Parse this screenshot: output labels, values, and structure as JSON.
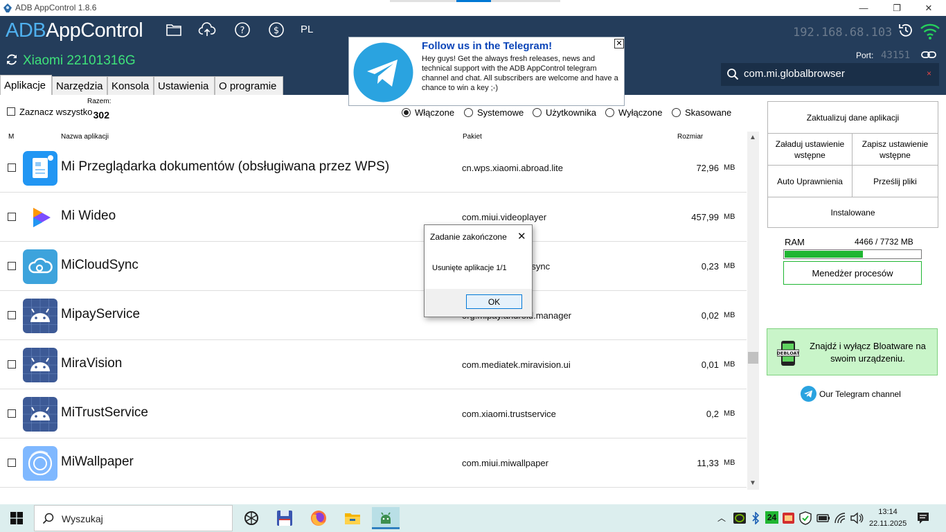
{
  "window": {
    "title": "ADB AppControl 1.8.6",
    "minimize": "—",
    "maximize": "❐",
    "close": "✕"
  },
  "header": {
    "logo_prefix": "ADB",
    "logo_main": "AppControl",
    "language": "PL",
    "device_name": "Xiaomi 22101316G",
    "ip": "192.168.68.103",
    "port_label": "Port:",
    "port_value": "43151",
    "search_value": "com.mi.globalbrowser",
    "search_clear": "×",
    "icons": [
      "folder-icon",
      "cloud-upload-icon",
      "help-icon",
      "donate-icon",
      "refresh-icon",
      "history-icon",
      "wifi-icon",
      "link-icon",
      "search-icon"
    ]
  },
  "banner": {
    "title": "Follow us in the Telegram!",
    "text": "Hey guys! Get the always fresh releases, news and technical support with the ADB AppControl telegram channel and chat. All subscribers are welcome and have a chance to win a key ;-)",
    "close": "✕"
  },
  "tabs": [
    {
      "label": "Aplikacje",
      "active": true
    },
    {
      "label": "Narzędzia",
      "active": false
    },
    {
      "label": "Konsola",
      "active": false
    },
    {
      "label": "Ustawienia",
      "active": false
    },
    {
      "label": "O programie",
      "active": false
    }
  ],
  "filters": {
    "select_all": "Zaznacz wszystko",
    "total_label": "Razem:",
    "total_value": "302",
    "radios": [
      {
        "label": "Włączone",
        "checked": true
      },
      {
        "label": "Systemowe",
        "checked": false
      },
      {
        "label": "Użytkownika",
        "checked": false
      },
      {
        "label": "Wyłączone",
        "checked": false
      },
      {
        "label": "Skasowane",
        "checked": false
      }
    ]
  },
  "table": {
    "columns": [
      "M",
      "Nazwa aplikacji",
      "Pakiet",
      "Rozmiar"
    ],
    "rows": [
      {
        "name": "Mi Przeglądarka dokumentów (obsługiwana przez WPS)",
        "package": "cn.wps.xiaomi.abroad.lite",
        "size": "72,96",
        "unit": "MB",
        "icon": "document-viewer-icon"
      },
      {
        "name": "Mi Wideo",
        "package": "com.miui.videoplayer",
        "size": "457,99",
        "unit": "MB",
        "icon": "video-player-icon"
      },
      {
        "name": "MiCloudSync",
        "package": "com.miui.micloudsync",
        "size": "0,23",
        "unit": "MB",
        "icon": "cloud-sync-icon"
      },
      {
        "name": "MipayService",
        "package": "org.mipay.android.manager",
        "size": "0,02",
        "unit": "MB",
        "icon": "android-icon"
      },
      {
        "name": "MiraVision",
        "package": "com.mediatek.miravision.ui",
        "size": "0,01",
        "unit": "MB",
        "icon": "android-icon"
      },
      {
        "name": "MiTrustService",
        "package": "com.xiaomi.trustservice",
        "size": "0,2",
        "unit": "MB",
        "icon": "android-icon"
      },
      {
        "name": "MiWallpaper",
        "package": "com.miui.miwallpaper",
        "size": "11,33",
        "unit": "MB",
        "icon": "wallpaper-icon"
      }
    ]
  },
  "sidebar": {
    "update_data": "Zaktualizuj dane aplikacji",
    "load_preset": "Załaduj ustawienie wstępne",
    "save_preset": "Zapisz ustawienie wstępne",
    "auto_permissions": "Auto Uprawnienia",
    "send_files": "Prześlij pliki",
    "installed": "Instalowane",
    "ram_label": "RAM",
    "ram_value": "4466 / 7732 MB",
    "ram_used": 4466,
    "ram_total": 7732,
    "process_manager": "Menedżer procesów",
    "debloat_text": "Znajdź i wyłącz Bloatware na swoim urządzeniu.",
    "debloat_badge": "DEBLOAT",
    "telegram_channel": "Our Telegram channel"
  },
  "dialog": {
    "title": "Zadanie zakończone",
    "message": "Usunięte aplikacje 1/1",
    "ok": "OK",
    "close": "✕"
  },
  "taskbar": {
    "search_placeholder": "Wyszukaj",
    "tray_badge": "24",
    "time": "13:14",
    "date": "22.11.2025",
    "apps": [
      "chatgpt-icon",
      "save-disk-icon",
      "firefox-icon",
      "file-explorer-icon",
      "adb-appcontrol-icon"
    ]
  },
  "colors": {
    "header_bg": "#243d5b",
    "logo_accent": "#4fb0ee",
    "device_green": "#3ee27a",
    "ram_fill": "#1fb632",
    "banner_title": "#0b45b8",
    "taskbar_bg": "#dceeee"
  }
}
